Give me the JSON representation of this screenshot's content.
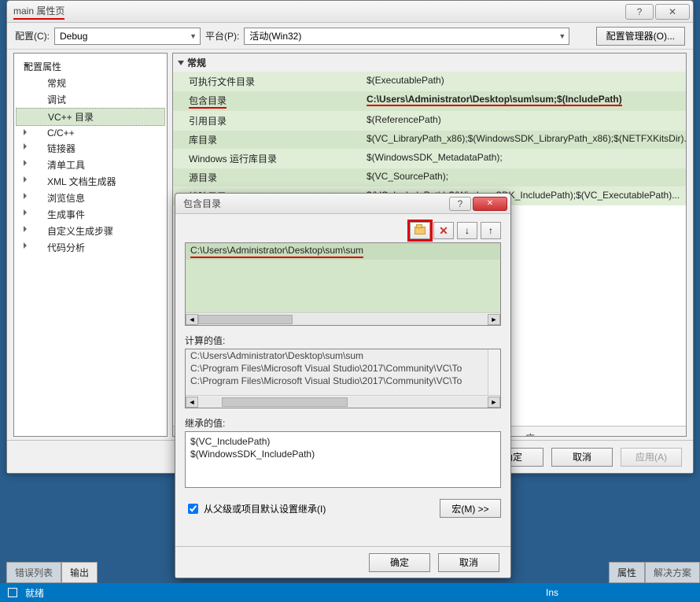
{
  "main_window": {
    "title": "main 属性页",
    "titlebar": {
      "help": "?",
      "close": "✕"
    }
  },
  "toolbar": {
    "config_label": "配置(C):",
    "config_value": "Debug",
    "platform_label": "平台(P):",
    "platform_value": "活动(Win32)",
    "config_mgr": "配置管理器(O)..."
  },
  "tree": {
    "root": "配置属性",
    "items": [
      {
        "label": "常规",
        "expandable": false
      },
      {
        "label": "调试",
        "expandable": false
      },
      {
        "label": "VC++ 目录",
        "expandable": false,
        "selected": true
      },
      {
        "label": "C/C++",
        "expandable": true
      },
      {
        "label": "链接器",
        "expandable": true
      },
      {
        "label": "清单工具",
        "expandable": true
      },
      {
        "label": "XML 文档生成器",
        "expandable": true
      },
      {
        "label": "浏览信息",
        "expandable": true
      },
      {
        "label": "生成事件",
        "expandable": true
      },
      {
        "label": "自定义生成步骤",
        "expandable": true
      },
      {
        "label": "代码分析",
        "expandable": true
      }
    ]
  },
  "props": {
    "group": "常规",
    "rows": [
      {
        "label": "可执行文件目录",
        "value": "$(ExecutablePath)"
      },
      {
        "label": "包含目录",
        "value": "C:\\Users\\Administrator\\Desktop\\sum\\sum;$(IncludePath)",
        "bold": true,
        "highlight": true
      },
      {
        "label": "引用目录",
        "value": "$(ReferencePath)"
      },
      {
        "label": "库目录",
        "value": "$(VC_LibraryPath_x86);$(WindowsSDK_LibraryPath_x86);$(NETFXKitsDir)..."
      },
      {
        "label": "Windows 运行库目录",
        "value": "$(WindowsSDK_MetadataPath);"
      },
      {
        "label": "源目录",
        "value": "$(VC_SourcePath);"
      },
      {
        "label": "排除目录",
        "value": "$(VC_IncludePath);$(WindowsSDK_IncludePath);$(VC_ExecutablePath)..."
      }
    ]
  },
  "desc_tail": "应。",
  "footer": {
    "ok": "确定",
    "cancel": "取消",
    "apply": "应用(A)"
  },
  "sub_dialog": {
    "title": "包含目录",
    "toolbar_icons": {
      "new": "folder",
      "del": "✕",
      "down": "↓",
      "up": "↑"
    },
    "paths": [
      "C:\\Users\\Administrator\\Desktop\\sum\\sum"
    ],
    "computed_label": "计算的值:",
    "computed": [
      "C:\\Users\\Administrator\\Desktop\\sum\\sum",
      "C:\\Program Files\\Microsoft Visual Studio\\2017\\Community\\VC\\To",
      "C:\\Program Files\\Microsoft Visual Studio\\2017\\Community\\VC\\To"
    ],
    "inherit_label": "继承的值:",
    "inherited": [
      "$(VC_IncludePath)",
      "$(WindowsSDK_IncludePath)"
    ],
    "inherit_check": "从父级或项目默认设置继承(I)",
    "inherit_checked": true,
    "macros_btn": "宏(M) >>",
    "ok": "确定",
    "cancel": "取消"
  },
  "bottom": {
    "tab_errors": "错误列表",
    "tab_output": "输出",
    "tab_props": "属性",
    "tab_sol": "解决方案"
  },
  "status": {
    "ready": "就绪",
    "ins": "Ins"
  }
}
